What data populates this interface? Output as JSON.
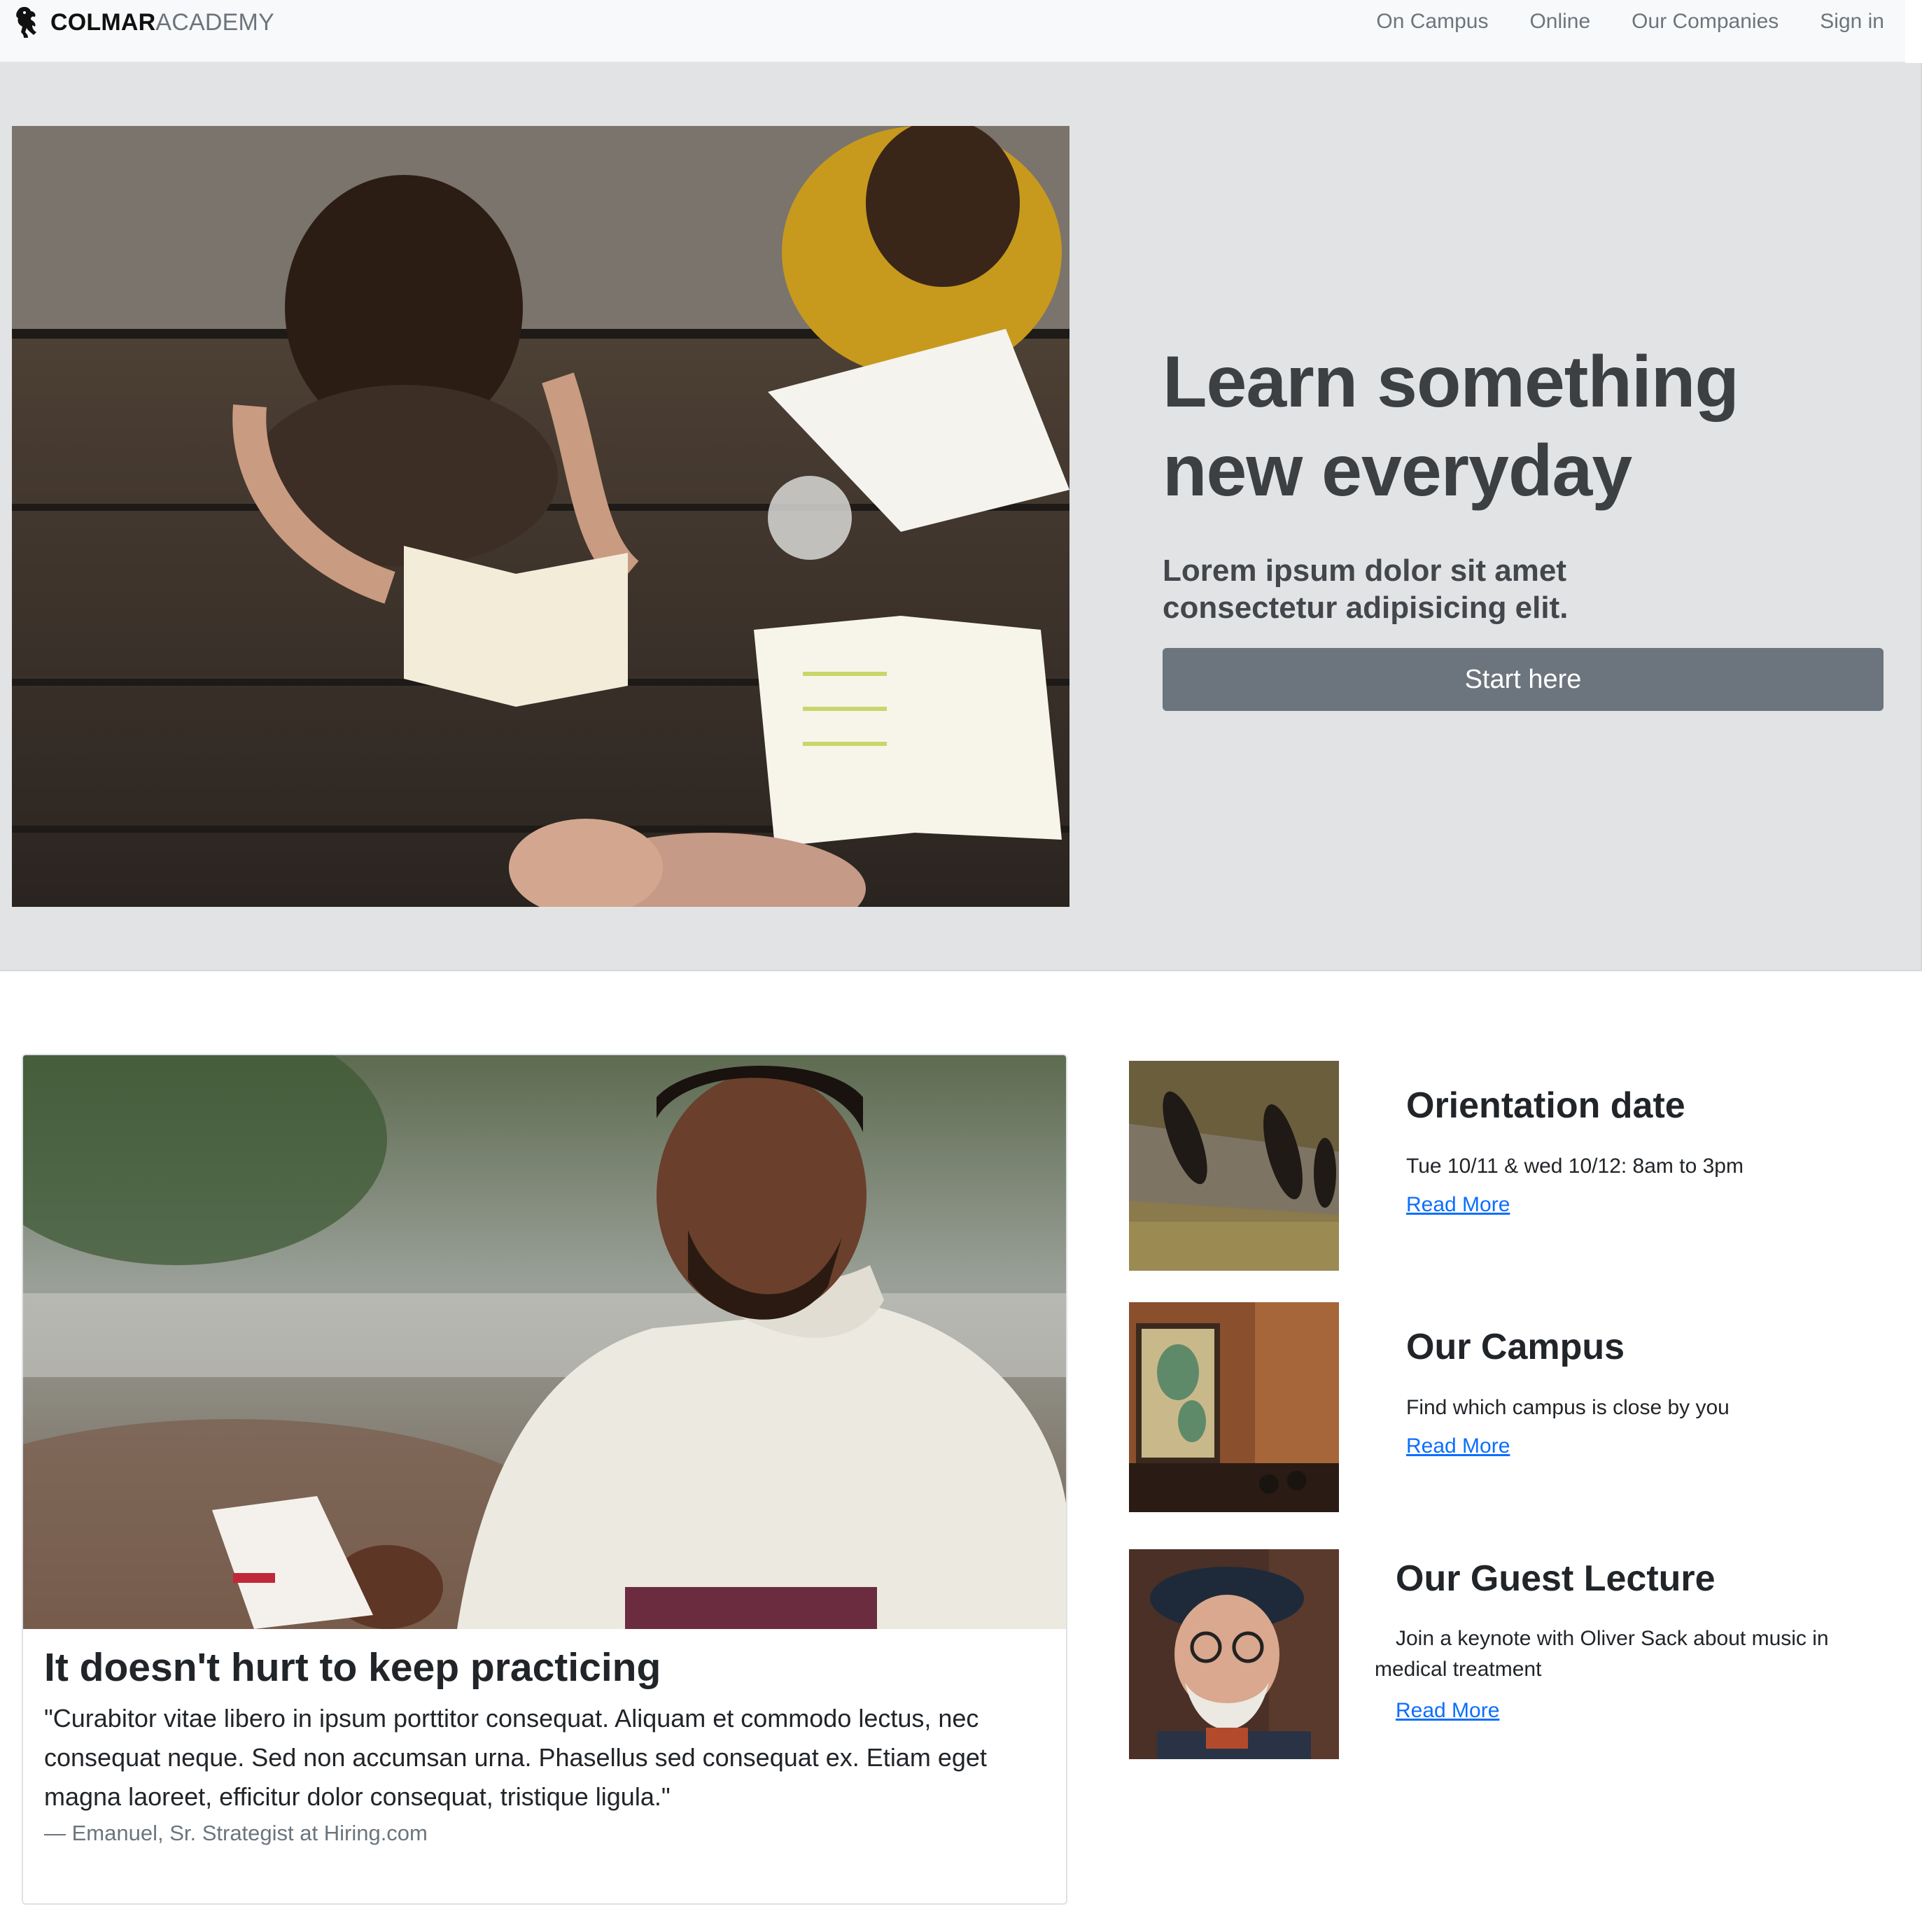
{
  "navbar": {
    "brand_bold": "COLMAR",
    "brand_light": "ACADEMY",
    "logo_icon": "lion-rampant-icon",
    "links": [
      "On Campus",
      "Online",
      "Our Companies",
      "Sign in"
    ]
  },
  "hero": {
    "image": "students-reading-at-picnic-table-photo",
    "title_line1": "Learn something",
    "title_line2": "new everyday",
    "subtitle_line1": "Lorem ipsum dolor sit amet",
    "subtitle_line2": "consectetur adipisicing elit.",
    "button_label": "Start here"
  },
  "feature": {
    "image": "man-reading-book-outdoors-photo",
    "title": "It doesn't hurt to keep practicing",
    "quote": "\"Curabitor vitae libero in ipsum porttitor consequat. Aliquam et commodo lectus, nec consequat neque. Sed non accumsan urna. Phasellus sed consequat ex. Etiam eget magna laoreet, efficitur dolor consequat, tristique ligula.\"",
    "attribution": "— Emanuel, Sr. Strategist at Hiring.com"
  },
  "side_items": [
    {
      "image": "people-shadows-aerial-photo",
      "title": "Orientation date",
      "description": "Tue 10/11 & wed 10/12: 8am to 3pm",
      "link": "Read More"
    },
    {
      "image": "campus-interior-map-photo",
      "title": "Our Campus",
      "description": "Find which campus is close by you",
      "link": "Read More"
    },
    {
      "image": "elderly-man-beret-portrait-photo",
      "title": "Our Guest Lecture",
      "description_line1": "Join a keynote with Oliver Sack about music in",
      "description_line2": "medical treatment",
      "link": "Read More"
    }
  ],
  "colors": {
    "navbar_bg": "#f8f9fa",
    "hero_bg": "#e2e3e5",
    "button_bg": "#6c757d",
    "link": "#0d6efd",
    "muted_text": "#6c757d"
  }
}
